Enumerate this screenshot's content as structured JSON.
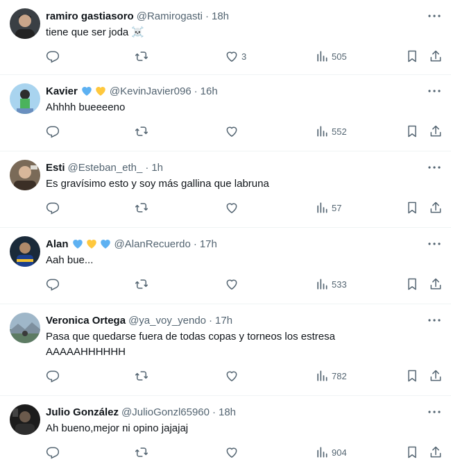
{
  "colors": {
    "text_primary": "#0f1419",
    "text_secondary": "#536471",
    "divider": "#eff3f4",
    "heart_blue": "#5db1f2",
    "heart_yellow": "#ffc83d"
  },
  "tweets": [
    {
      "name": "ramiro gastiasoro",
      "handle": "@Ramirogasti",
      "separator": "·",
      "time": "18h",
      "text": "tiene que ser joda ☠️",
      "badges": [],
      "likes": "3",
      "views": "505"
    },
    {
      "name": "Kavier",
      "handle": "@KevinJavier096",
      "separator": "·",
      "time": "16h",
      "text": "Ahhhh bueeeeno",
      "badges": [
        "blue-heart-icon",
        "yellow-heart-icon"
      ],
      "likes": "",
      "views": "552"
    },
    {
      "name": "Esti",
      "handle": "@Esteban_eth_",
      "separator": "·",
      "time": "1h",
      "text": "Es gravísimo esto y soy más gallina que labruna",
      "badges": [],
      "likes": "",
      "views": "57"
    },
    {
      "name": "Alan",
      "handle": "@AlanRecuerdo",
      "separator": "·",
      "time": "17h",
      "text": "Aah bue...",
      "badges": [
        "blue-heart-icon",
        "yellow-heart-icon",
        "blue-heart-icon"
      ],
      "likes": "",
      "views": "533"
    },
    {
      "name": "Veronica Ortega",
      "handle": "@ya_voy_yendo",
      "separator": "·",
      "time": "17h",
      "text": "Pasa que quedarse fuera de todas copas y torneos los estresa\nAAAAAHHHHHH",
      "badges": [],
      "likes": "",
      "views": "782"
    },
    {
      "name": "Julio González",
      "handle": "@JulioGonzl65960",
      "separator": "·",
      "time": "18h",
      "text": "Ah bueno,mejor ni opino jajajaj",
      "badges": [],
      "likes": "",
      "views": "904"
    }
  ]
}
